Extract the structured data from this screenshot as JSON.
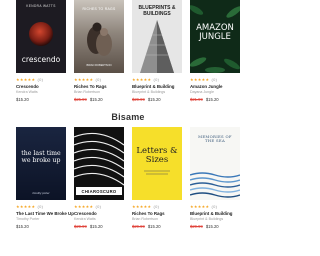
{
  "rows": [
    {
      "cards": [
        {
          "cover": {
            "top": "KENDRA WATTS",
            "main": "crescendo",
            "bottom": ""
          },
          "stars": "★★★★★",
          "rating_count": "(0)",
          "title": "Crescendo",
          "author": "Kendra Watts",
          "old_price": "",
          "price": "$15.20"
        },
        {
          "cover": {
            "top": "",
            "main": "RICHES TO RAGS",
            "bottom": "BRIAN ROBERTSON"
          },
          "stars": "★★★★★",
          "rating_count": "(0)",
          "title": "Riches To Rags",
          "author": "Brian Robertson",
          "old_price": "$25.99",
          "price": "$15.20"
        },
        {
          "cover": {
            "top": "",
            "main": "BLUEPRINTS & BUILDINGS",
            "bottom": ""
          },
          "stars": "★★★★★",
          "rating_count": "(0)",
          "title": "Blueprint & Building",
          "author": "Blueprint & Buildings",
          "old_price": "$29.99",
          "price": "$15.20"
        },
        {
          "cover": {
            "top": "",
            "main": "AMAZON JUNGLE",
            "bottom": ""
          },
          "stars": "★★★★★",
          "rating_count": "(0)",
          "title": "Amazon Jungle",
          "author": "Dayana Jungle",
          "old_price": "$21.99",
          "price": "$15.20"
        }
      ]
    },
    {
      "cards": [
        {
          "cover": {
            "top": "",
            "main": "the last time we broke up",
            "bottom": "timothy porter"
          },
          "stars": "★★★★★",
          "rating_count": "(0)",
          "title": "The Last Time We Broke Up",
          "author": "Timothy Porter",
          "old_price": "",
          "price": "$15.20"
        },
        {
          "cover": {
            "top": "",
            "main": "CHIAROSCURO",
            "bottom": ""
          },
          "stars": "★★★★★",
          "rating_count": "(0)",
          "title": "Crescendo",
          "author": "Kendra Watts",
          "old_price": "$29.99",
          "price": "$15.20"
        },
        {
          "cover": {
            "top": "",
            "main": "Letters & Sizes",
            "bottom": ""
          },
          "stars": "★★★★★",
          "rating_count": "(0)",
          "title": "Riches To Rags",
          "author": "Brian Robertson",
          "old_price": "$29.99",
          "price": "$15.20"
        },
        {
          "cover": {
            "top": "",
            "main": "MEMORIES OF THE SEA",
            "bottom": ""
          },
          "stars": "★★★★★",
          "rating_count": "(0)",
          "title": "Blueprint & Building",
          "author": "Blueprint & Buildings",
          "old_price": "$29.99",
          "price": "$15.20"
        }
      ]
    }
  ],
  "brand": {
    "label": "Bisame"
  }
}
